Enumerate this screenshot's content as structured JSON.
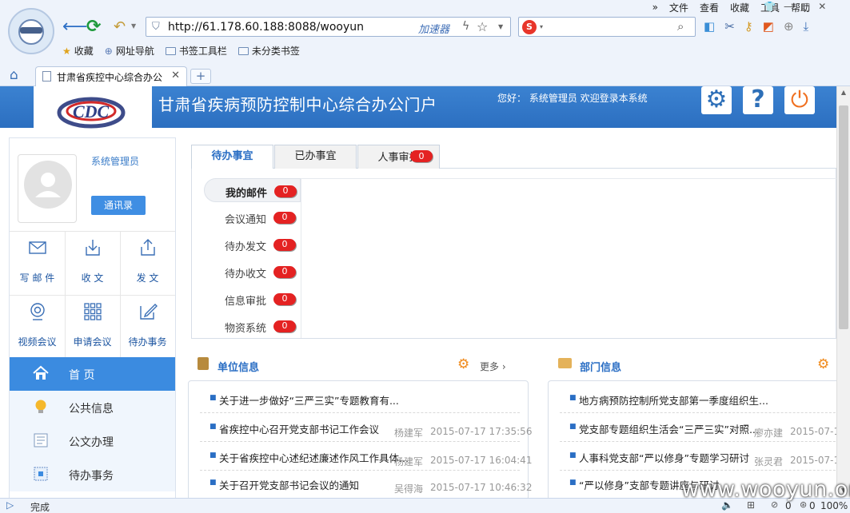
{
  "browser": {
    "menu": [
      "»",
      "文件",
      "查看",
      "收藏",
      "工具",
      "帮助"
    ],
    "url": "http://61.178.60.188:8088/wooyun",
    "accelerator": "加速器",
    "search_placeholder": "",
    "favorites": [
      {
        "label": "收藏",
        "icon": "star-icon"
      },
      {
        "label": "网址导航",
        "icon": "globe-icon"
      },
      {
        "label": "书签工具栏",
        "icon": "folder-icon"
      },
      {
        "label": "未分类书签",
        "icon": "folder-icon"
      }
    ],
    "tab_title": "甘肃省疾控中心综合办公",
    "status_text": "完成",
    "status_right": [
      "0",
      "0",
      "100%"
    ]
  },
  "header": {
    "title": "甘肃省疾病预防控制中心综合办公门户",
    "greeting": "您好：  系统管理员 欢迎登录本系统"
  },
  "user": {
    "name": "系统管理员",
    "contacts_button": "通讯录"
  },
  "quick_actions": [
    {
      "label": "写 邮 件",
      "icon": "mail-icon"
    },
    {
      "label": "收  文",
      "icon": "download-icon"
    },
    {
      "label": "发  文",
      "icon": "upload-icon"
    },
    {
      "label": "视频会议",
      "icon": "webcam-icon"
    },
    {
      "label": "申请会议",
      "icon": "grid-icon"
    },
    {
      "label": "待办事务",
      "icon": "edit-icon"
    }
  ],
  "nav": [
    {
      "label": "首  页",
      "icon": "home-icon"
    },
    {
      "label": "公共信息",
      "icon": "lightbulb-icon"
    },
    {
      "label": "公文办理",
      "icon": "document-icon"
    },
    {
      "label": "待办事务",
      "icon": "task-icon"
    }
  ],
  "tabs": [
    {
      "label": "待办事宜"
    },
    {
      "label": "已办事宜"
    },
    {
      "label": "人事审批",
      "count": "0"
    }
  ],
  "mail_items": [
    {
      "label": "我的邮件",
      "count": "0"
    },
    {
      "label": "会议通知",
      "count": "0"
    },
    {
      "label": "待办发文",
      "count": "0"
    },
    {
      "label": "待办收文",
      "count": "0"
    },
    {
      "label": "信息审批",
      "count": "0"
    },
    {
      "label": "物资系统",
      "count": "0"
    }
  ],
  "unit_info": {
    "title": "单位信息",
    "more": "更多",
    "items": [
      {
        "title": "关于进一步做好“三严三实”专题教育有...",
        "author": "",
        "date": ""
      },
      {
        "title": "省疾控中心召开党支部书记工作会议",
        "author": "杨建军",
        "date": "2015-07-17 17:35:56"
      },
      {
        "title": "关于省疾控中心述纪述廉述作风工作具体...",
        "author": "杨建军",
        "date": "2015-07-17 16:04:41"
      },
      {
        "title": "关于召开党支部书记会议的通知",
        "author": "吴得海",
        "date": "2015-07-17 10:46:32"
      }
    ]
  },
  "dept_info": {
    "title": "部门信息",
    "items": [
      {
        "title": "地方病预防控制所党支部第一季度组织生...",
        "author": "",
        "date": ""
      },
      {
        "title": "党支部专题组织生活会“三严三实”对照...",
        "author": "廖亦建",
        "date": "2015-07-1"
      },
      {
        "title": "人事科党支部“严以修身”专题学习研讨",
        "author": "张灵君",
        "date": "2015-07-1"
      },
      {
        "title": "“严以修身”支部专题讲座与研讨",
        "author": "",
        "date": ""
      }
    ]
  },
  "watermark": "www.wooyun.org"
}
